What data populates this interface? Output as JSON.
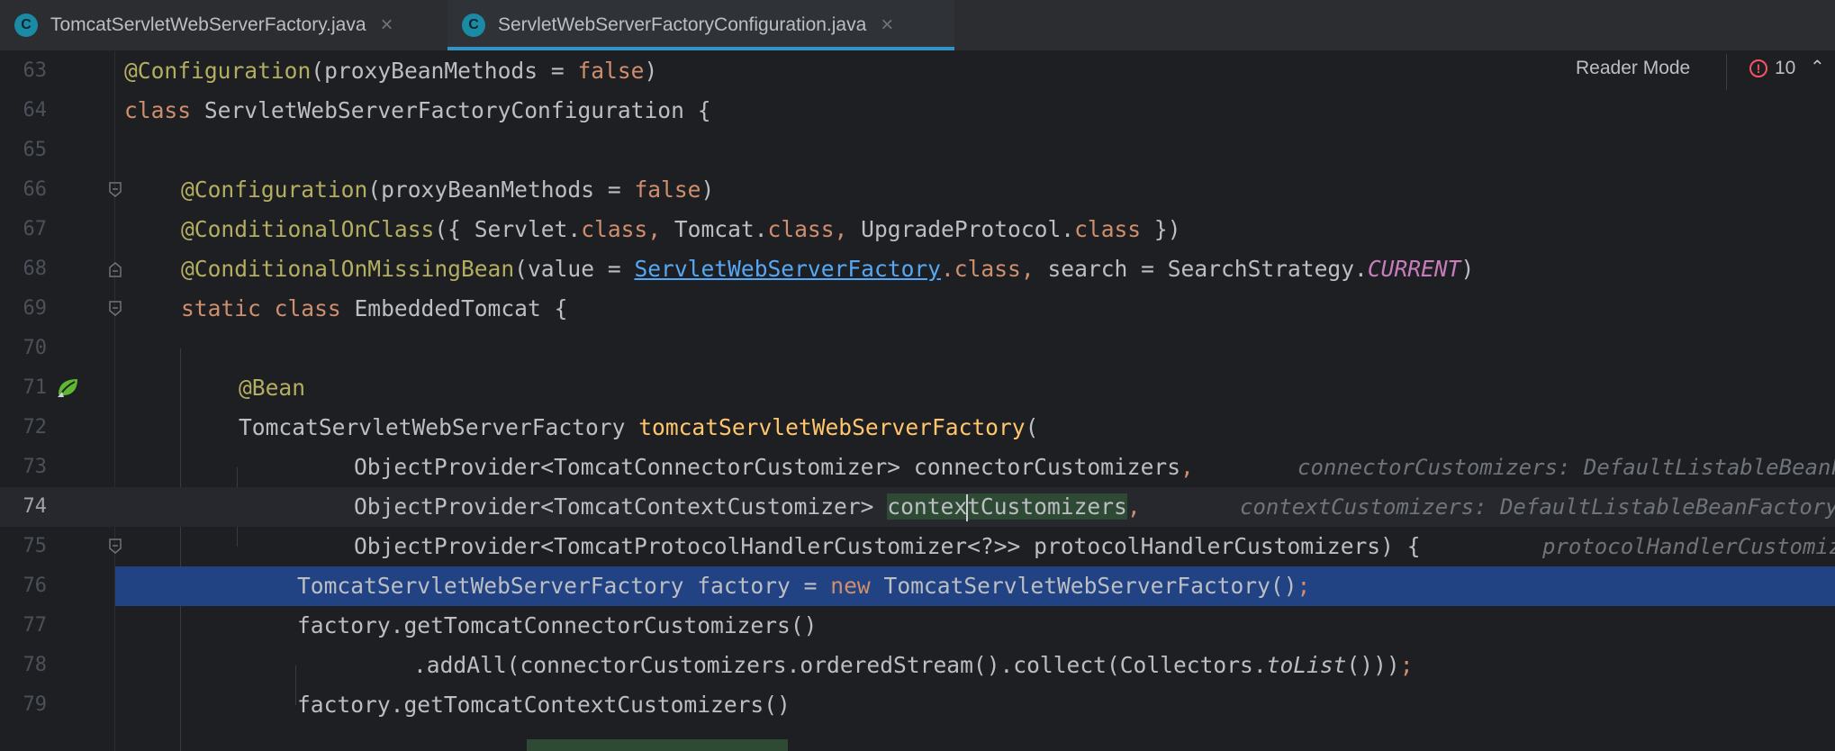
{
  "tabs": [
    {
      "label": "TomcatServletWebServerFactory.java",
      "icon": "C",
      "active": false
    },
    {
      "label": "ServletWebServerFactoryConfiguration.java",
      "icon": "C",
      "active": true
    }
  ],
  "toolbar": {
    "reader_mode": "Reader Mode",
    "problems_count": "10"
  },
  "code": {
    "l63": {
      "n": "63",
      "a": "@Configuration",
      "b": "(proxyBeanMethods = ",
      "c": "false",
      "d": ")"
    },
    "l64": {
      "n": "64",
      "a": "class",
      "b": " ServletWebServerFactoryConfiguration {"
    },
    "l65": {
      "n": "65"
    },
    "l66": {
      "n": "66",
      "a": "@Configuration",
      "b": "(proxyBeanMethods = ",
      "c": "false",
      "d": ")"
    },
    "l67": {
      "n": "67",
      "a": "@ConditionalOnClass",
      "b": "({ Servlet.",
      "c": "class,",
      "d": " Tomcat.",
      "e": "class,",
      "f": " UpgradeProtocol.",
      "g": "class",
      "h": " })"
    },
    "l68": {
      "n": "68",
      "a": "@ConditionalOnMissingBean",
      "b": "(value = ",
      "c": "ServletWebServerFactory",
      "d": ".class,",
      "e": " search = SearchStrategy.",
      "f": "CURRENT",
      "g": ")"
    },
    "l69": {
      "n": "69",
      "a": "static class",
      "b": " EmbeddedTomcat {"
    },
    "l70": {
      "n": "70"
    },
    "l71": {
      "n": "71",
      "a": "@Bean"
    },
    "l72": {
      "n": "72",
      "a": "TomcatServletWebServerFactory ",
      "b": "tomcatServletWebServerFactory",
      "c": "("
    },
    "l73": {
      "n": "73",
      "a": "ObjectProvider<TomcatConnectorCustomizer> connectorCustomizers",
      "b": ",",
      "hint": "connectorCustomizers: DefaultListableBeanFactory"
    },
    "l74": {
      "n": "74",
      "a": "ObjectProvider<TomcatContextCustomizer> ",
      "b": "contex",
      "c": "tCustomizers",
      "d": ",",
      "hint": "contextCustomizers: DefaultListableBeanFactory"
    },
    "l75": {
      "n": "75",
      "a": "ObjectProvider<TomcatProtocolHandlerCustomizer<?>> protocolHandlerCustomizers) {",
      "hint": "protocolHandlerCustomizers"
    },
    "l76": {
      "n": "76",
      "a": "TomcatServletWebServerFactory factory = ",
      "b": "new",
      "c": " TomcatServletWebServerFactory()",
      "d": ";"
    },
    "l77": {
      "n": "77",
      "a": "factory.getTomcatConnectorCustomizers()"
    },
    "l78": {
      "n": "78",
      "a": ".addAll(connectorCustomizers.orderedStream().collect(Collectors.",
      "b": "toList",
      "c": "()))",
      "d": ";"
    },
    "l79": {
      "n": "79",
      "a": "factory.getTomcatContextCustomizers()"
    }
  }
}
